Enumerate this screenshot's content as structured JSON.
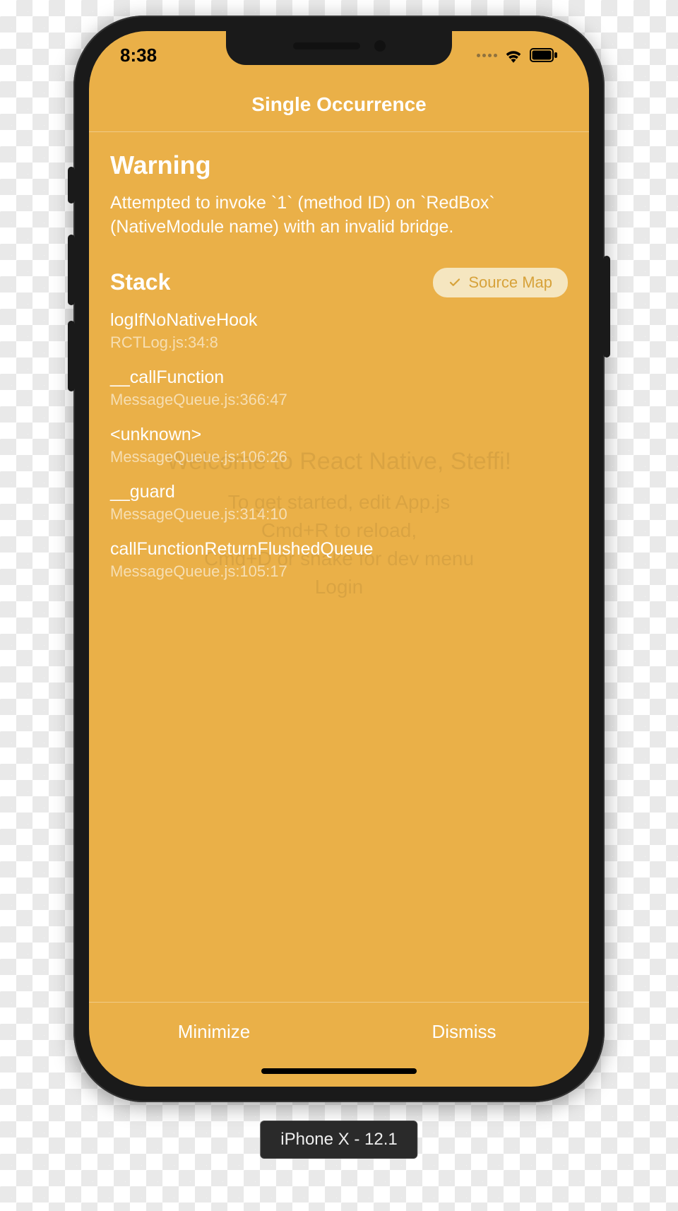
{
  "statusbar": {
    "time": "8:38"
  },
  "ghost": {
    "title": "Welcome to React Native, Steffi!",
    "line1": "To get started, edit App.js",
    "line2": "Cmd+R to reload,",
    "line3": "Cmd+D or shake for dev menu",
    "login": "Login"
  },
  "overlay": {
    "title": "Single Occurrence",
    "warning_heading": "Warning",
    "warning_message": "Attempted to invoke `1` (method ID) on `RedBox` (NativeModule name) with an invalid bridge.",
    "stack_heading": "Stack",
    "source_map_label": "Source Map",
    "frames": [
      {
        "fn": "logIfNoNativeHook",
        "loc": "RCTLog.js:34:8"
      },
      {
        "fn": "__callFunction",
        "loc": "MessageQueue.js:366:47"
      },
      {
        "fn": "<unknown>",
        "loc": "MessageQueue.js:106:26"
      },
      {
        "fn": "__guard",
        "loc": "MessageQueue.js:314:10"
      },
      {
        "fn": "callFunctionReturnFlushedQueue",
        "loc": "MessageQueue.js:105:17"
      }
    ],
    "minimize_label": "Minimize",
    "dismiss_label": "Dismiss"
  },
  "simulator_label": "iPhone X - 12.1"
}
